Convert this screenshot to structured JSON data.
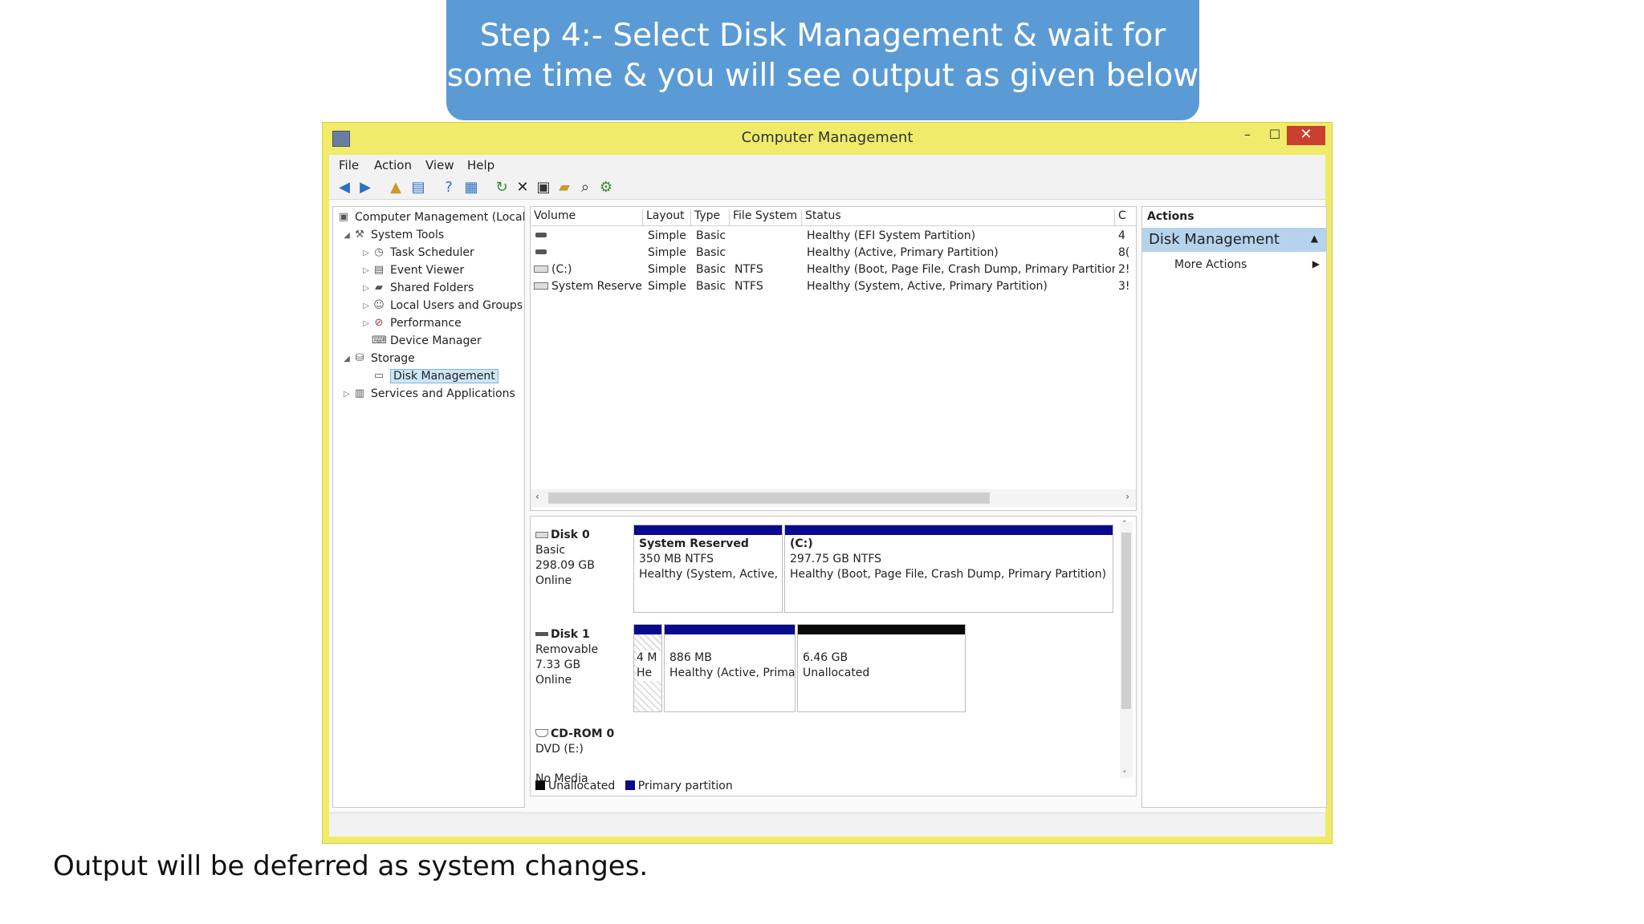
{
  "banner": {
    "line1": "Step 4:- Select Disk Management & wait for",
    "line2": "some time & you will see output as given below"
  },
  "footer_note": "Output will be deferred as system changes.",
  "window": {
    "title": "Computer Management",
    "minimize": "–",
    "maximize": "☐",
    "close": "✕"
  },
  "menu": [
    "File",
    "Action",
    "View",
    "Help"
  ],
  "tree": [
    {
      "label": "Computer Management (Local",
      "icon": "computer-management-icon"
    },
    {
      "label": "System Tools",
      "icon": "system-tools-icon"
    },
    {
      "label": "Task Scheduler",
      "icon": "clock-icon"
    },
    {
      "label": "Event Viewer",
      "icon": "event-viewer-icon"
    },
    {
      "label": "Shared Folders",
      "icon": "shared-folders-icon"
    },
    {
      "label": "Local Users and Groups",
      "icon": "users-icon"
    },
    {
      "label": "Performance",
      "icon": "performance-icon"
    },
    {
      "label": "Device Manager",
      "icon": "device-manager-icon"
    },
    {
      "label": "Storage",
      "icon": "storage-icon"
    },
    {
      "label": "Disk Management",
      "icon": "disk-management-icon"
    },
    {
      "label": "Services and Applications",
      "icon": "services-icon"
    }
  ],
  "volume_table": {
    "headers": [
      "Volume",
      "Layout",
      "Type",
      "File System",
      "Status",
      "C"
    ],
    "rows": [
      {
        "volume": "",
        "layout": "Simple",
        "type": "Basic",
        "fs": "",
        "status": "Healthy (EFI System Partition)",
        "cap": "4"
      },
      {
        "volume": "",
        "layout": "Simple",
        "type": "Basic",
        "fs": "",
        "status": "Healthy (Active, Primary Partition)",
        "cap": "8("
      },
      {
        "volume": "(C:)",
        "layout": "Simple",
        "type": "Basic",
        "fs": "NTFS",
        "status": "Healthy (Boot, Page File, Crash Dump, Primary Partition)",
        "cap": "2!"
      },
      {
        "volume": "System Reserved",
        "layout": "Simple",
        "type": "Basic",
        "fs": "NTFS",
        "status": "Healthy (System, Active, Primary Partition)",
        "cap": "3!"
      }
    ]
  },
  "disks": [
    {
      "name": "Disk 0",
      "kind": "Basic",
      "size": "298.09 GB",
      "state": "Online",
      "partitions": [
        {
          "title": "System Reserved",
          "line1": "350 MB NTFS",
          "line2": "Healthy (System, Active, I"
        },
        {
          "title": "(C:)",
          "line1": "297.75 GB NTFS",
          "line2": "Healthy (Boot, Page File, Crash Dump, Primary Partition)"
        }
      ]
    },
    {
      "name": "Disk 1",
      "kind": "Removable",
      "size": "7.33 GB",
      "state": "Online",
      "partitions": [
        {
          "title": "",
          "line1": "4 M",
          "line2": "He"
        },
        {
          "title": "",
          "line1": "886 MB",
          "line2": "Healthy (Active, Prima"
        },
        {
          "title": "",
          "line1": "6.46 GB",
          "line2": "Unallocated"
        }
      ]
    },
    {
      "name": "CD-ROM 0",
      "kind": "DVD (E:)",
      "size": "",
      "state": "No Media",
      "partitions": []
    }
  ],
  "legend": {
    "unallocated": "Unallocated",
    "primary": "Primary partition"
  },
  "actions": {
    "header": "Actions",
    "selected": "Disk Management",
    "more": "More Actions"
  },
  "colors": {
    "banner": "#5b9bd5",
    "window_frame": "#f0eb6a",
    "primary_bar": "#0a0a8c",
    "unallocated_bar": "#0a0a0a",
    "close_button": "#c9402f"
  }
}
